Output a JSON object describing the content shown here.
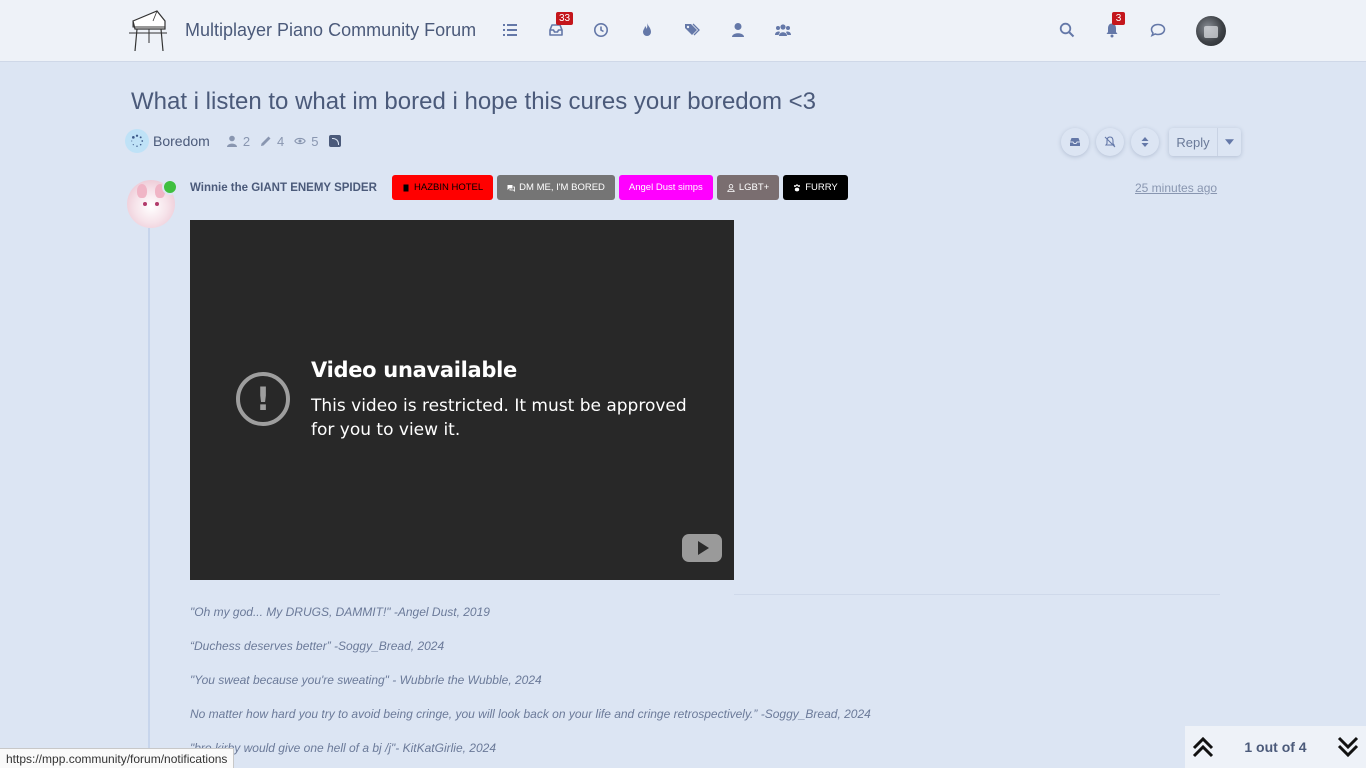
{
  "header": {
    "site_title": "Multiplayer Piano Community Forum",
    "nav": [
      {
        "name": "categories-icon"
      },
      {
        "name": "unread-icon",
        "badge": "33"
      },
      {
        "name": "recent-icon"
      },
      {
        "name": "popular-icon"
      },
      {
        "name": "tags-icon"
      },
      {
        "name": "users-icon"
      },
      {
        "name": "groups-icon"
      }
    ],
    "right": {
      "notifications_badge": "3"
    }
  },
  "topic": {
    "title": "What i listen to what im bored i hope this cures your boredom <3",
    "category": "Boredom",
    "posters": "2",
    "posts": "4",
    "views": "5",
    "reply_label": "Reply"
  },
  "post": {
    "username": "Winnie the GIANT ENEMY SPIDER",
    "badges": [
      {
        "label": "HAZBIN HOTEL",
        "bg": "#ff0000",
        "fg": "#000000",
        "icon": "hotel-icon"
      },
      {
        "label": "DM ME, I'M BORED",
        "bg": "#757575",
        "fg": "#ffffff",
        "icon": "comments-icon"
      },
      {
        "label": "Angel Dust simps",
        "bg": "#ff00ff",
        "fg": "#ffffff",
        "icon": ""
      },
      {
        "label": "LGBT+",
        "bg": "#7a6e70",
        "fg": "#ffffff",
        "icon": "user-icon"
      },
      {
        "label": "FURRY",
        "bg": "#000000",
        "fg": "#ffffff",
        "icon": "paw-icon"
      }
    ],
    "timestamp": "25 minutes ago",
    "video": {
      "title": "Video unavailable",
      "message": "This video is restricted. It must be approved for you to view it."
    },
    "quotes": [
      "\"Oh my god... My DRUGS, DAMMIT!\" -Angel Dust, 2019",
      "“Duchess deserves better” -Soggy_Bread, 2024",
      "\"You sweat because you're sweating\" - Wubbrle the Wubble, 2024",
      "No matter how hard you try to avoid being cringe, you will look back on your life and cringe retrospectively.” -Soggy_Bread, 2024",
      "\"bro kirby would give one hell of a bj /j\"- KitKatGirlie, 2024"
    ]
  },
  "statusbar": {
    "url": "https://mpp.community/forum/notifications"
  },
  "pagination": {
    "label": "1 out of 4"
  }
}
